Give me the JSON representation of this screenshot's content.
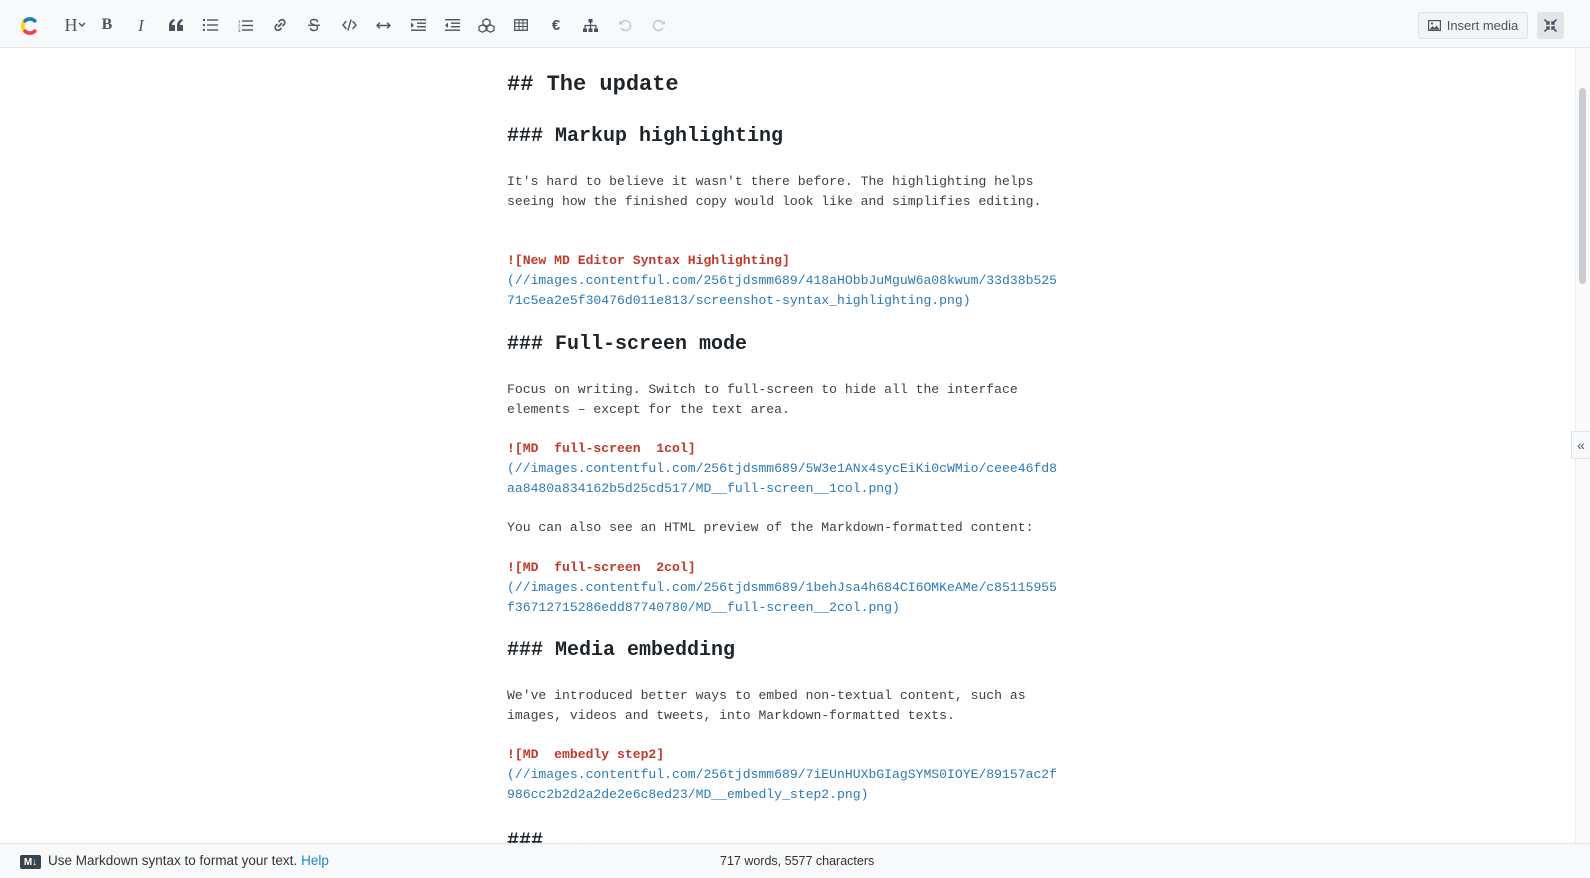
{
  "toolbar": {
    "heading_label": "H",
    "bold_label": "B",
    "italic_label": "I",
    "currency_label": "€",
    "insert_media_label": "Insert media"
  },
  "document": {
    "h2_update": "## The update",
    "h3_markup": "### Markup highlighting",
    "p1_line1": "It's hard to believe it wasn't there before. The highlighting helps",
    "p1_line2": "seeing how the finished copy would look like and simplifies editing.",
    "img1_alt": "![New MD Editor Syntax Highlighting]",
    "img1_url1": "(//images.contentful.com/256tjdsmm689/418aHObbJuMguW6a08kwum/33d38b525",
    "img1_url2": "71c5ea2e5f30476d011e813/screenshot-syntax_highlighting.png)",
    "h3_fullscreen": "### Full-screen mode",
    "p2_line1": "Focus on writing. Switch to full-screen to hide all the interface",
    "p2_line2": "elements – except for the text area.",
    "img2_alt": "![MD  full-screen  1col]",
    "img2_url1": "(//images.contentful.com/256tjdsmm689/5W3e1ANx4sycEiKi0cWMio/ceee46fd8",
    "img2_url2": "aa8480a834162b5d25cd517/MD__full-screen__1col.png)",
    "p3": "You can also see an HTML preview of the Markdown-formatted content:",
    "img3_alt": "![MD  full-screen  2col]",
    "img3_url1": "(//images.contentful.com/256tjdsmm689/1behJsa4h684CI6OMKeAMe/c85115955",
    "img3_url2": "f36712715286edd87740780/MD__full-screen__2col.png)",
    "h3_media": "### Media embedding",
    "p4_line1": "We've introduced better ways to embed non-textual content, such as",
    "p4_line2": "images, videos and tweets, into Markdown-formatted texts.",
    "img4_alt": "![MD  embedly step2]",
    "img4_url1": "(//images.contentful.com/256tjdsmm689/7iEUnHUXbGIagSYMS0IOYE/89157ac2f",
    "img4_url2": "986cc2b2d2a2de2e6c8ed23/MD__embedly_step2.png)",
    "partial_heading": "### ..."
  },
  "sidebar_toggle": {
    "label": "«"
  },
  "footer": {
    "badge": "M↓",
    "hint": "Use Markdown syntax to format your text.",
    "help_link": "Help",
    "word_count": "717 words, 5577 characters"
  },
  "colors": {
    "link": "#2a7ab8",
    "image_alt": "#c0392b",
    "help": "#1e88c8"
  }
}
